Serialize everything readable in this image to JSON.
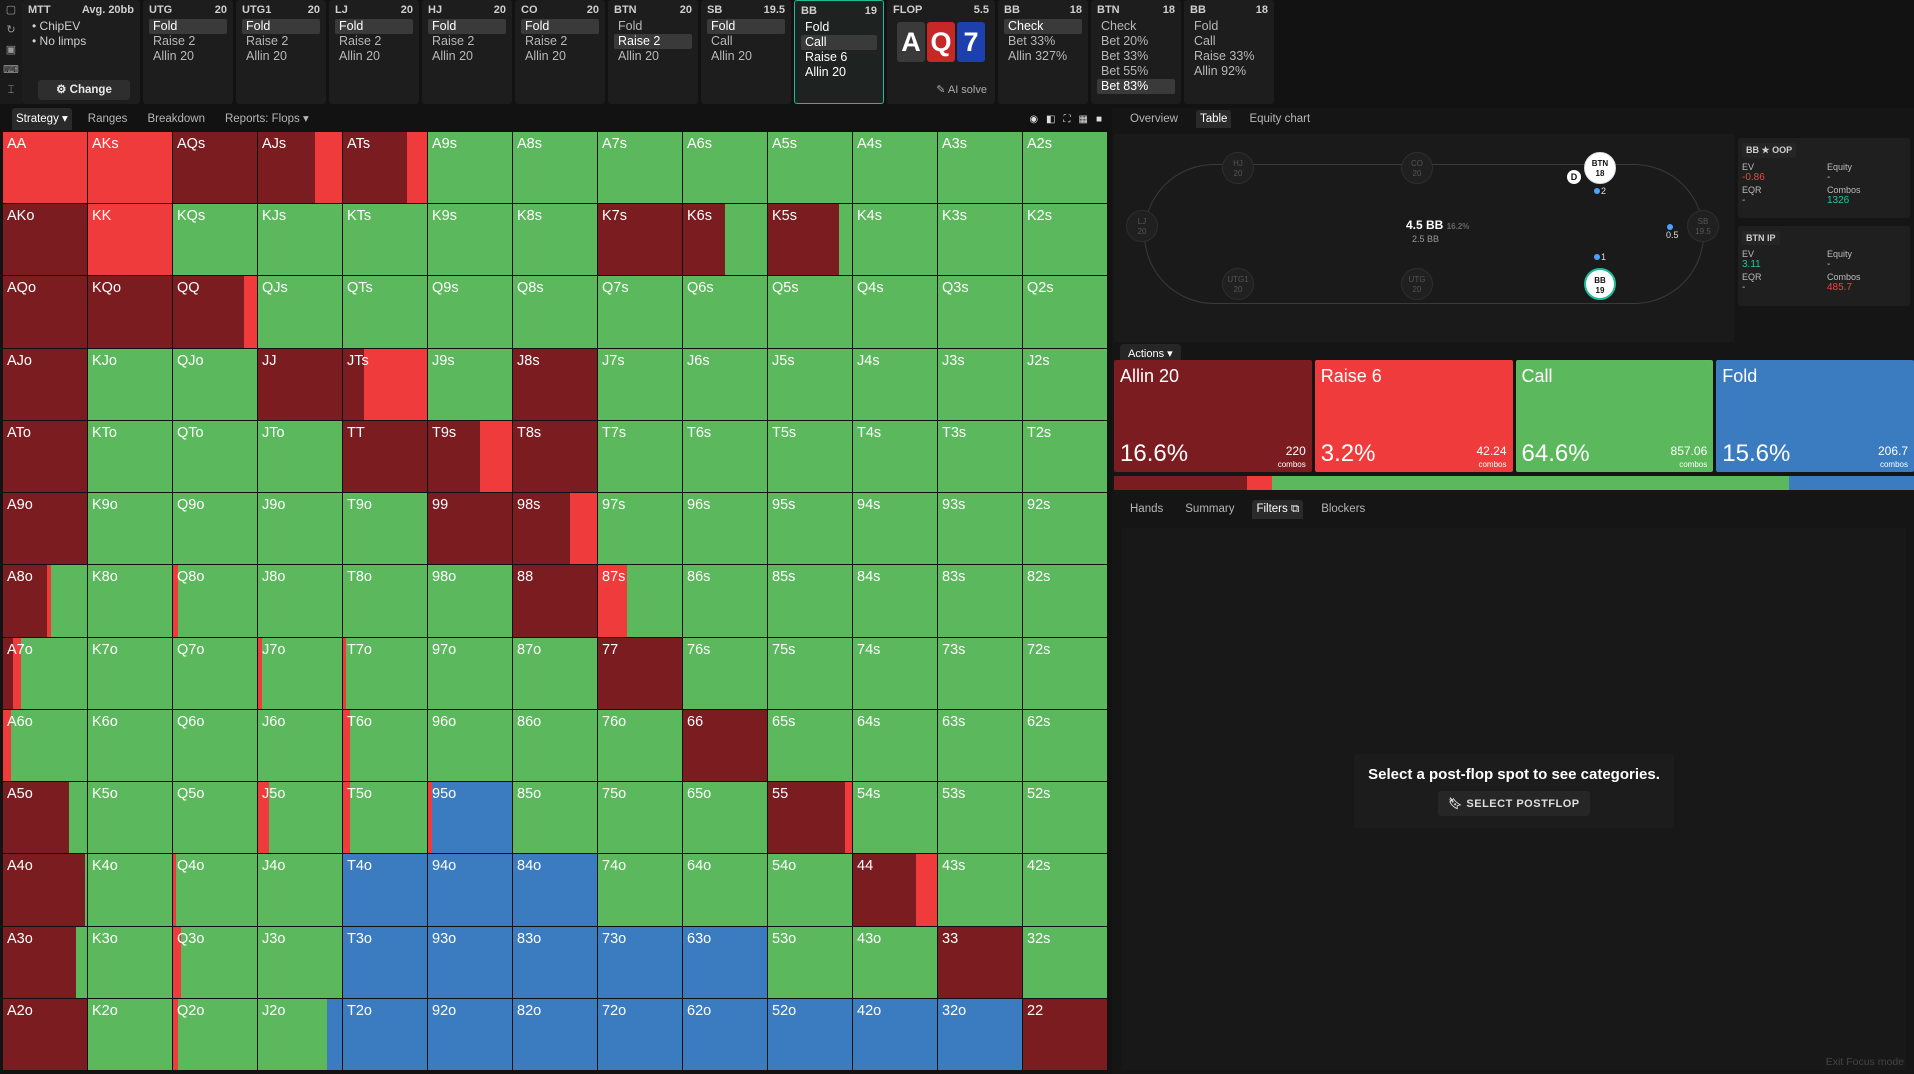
{
  "topbar": {
    "game": {
      "title": "MTT",
      "avg": "Avg. 20bb",
      "bullets": [
        "ChipEV",
        "No limps"
      ],
      "button": "Change"
    },
    "positions": [
      {
        "pos": "UTG",
        "stack": "20",
        "options": [
          "Fold",
          "Raise 2",
          "Allin 20"
        ],
        "active": 0
      },
      {
        "pos": "UTG1",
        "stack": "20",
        "options": [
          "Fold",
          "Raise 2",
          "Allin 20"
        ],
        "active": 0
      },
      {
        "pos": "LJ",
        "stack": "20",
        "options": [
          "Fold",
          "Raise 2",
          "Allin 20"
        ],
        "active": 0
      },
      {
        "pos": "HJ",
        "stack": "20",
        "options": [
          "Fold",
          "Raise 2",
          "Allin 20"
        ],
        "active": 0
      },
      {
        "pos": "CO",
        "stack": "20",
        "options": [
          "Fold",
          "Raise 2",
          "Allin 20"
        ],
        "active": 0
      },
      {
        "pos": "BTN",
        "stack": "20",
        "options": [
          "Fold",
          "Raise 2",
          "Allin 20"
        ],
        "active": 1
      },
      {
        "pos": "SB",
        "stack": "19.5",
        "options": [
          "Fold",
          "Call",
          "Allin 20"
        ],
        "active": 0
      },
      {
        "pos": "BB",
        "stack": "19",
        "options": [
          "Fold",
          "Call",
          "Raise 6",
          "Allin 20"
        ],
        "active": 1
      }
    ],
    "flop": {
      "label": "FLOP",
      "pot": "5.5",
      "cards": [
        {
          "rank": "A",
          "color": "#3a3a3a"
        },
        {
          "rank": "Q",
          "color": "#c62828"
        },
        {
          "rank": "7",
          "color": "#1e40af"
        }
      ],
      "ai": "AI solve"
    },
    "post": [
      {
        "pos": "BB",
        "stack": "18",
        "options": [
          "Check",
          "Bet 33%",
          "Allin 327%"
        ],
        "active": 0
      },
      {
        "pos": "BTN",
        "stack": "18",
        "options": [
          "Check",
          "Bet 20%",
          "Bet 33%",
          "Bet 55%",
          "Bet 83%"
        ],
        "active": 4
      },
      {
        "pos": "BB",
        "stack": "18",
        "options": [
          "Fold",
          "Call",
          "Raise 33%",
          "Allin 92%"
        ],
        "active": -1
      }
    ]
  },
  "toolbar": {
    "tabs": [
      "Strategy",
      "Ranges",
      "Breakdown",
      "Reports: Flops"
    ]
  },
  "colors": {
    "allin": "#7a1c20",
    "raise": "#ef3b3b",
    "call": "#5cb85c",
    "fold": "#3b7bbf"
  },
  "grid": [
    [
      "AA:r100",
      "AKs:r100",
      "AQs:a100",
      "AJs:a68 r32",
      "ATs:a76 r24",
      "A9s:c100",
      "A8s:c100",
      "A7s:c100",
      "A6s:c100",
      "A5s:c100",
      "A4s:c100",
      "A3s:c100",
      "A2s:c100"
    ],
    [
      "AKo:a100",
      "KK:r100",
      "KQs:c100",
      "KJs:c100",
      "KTs:c100",
      "K9s:c100",
      "K8s:c100",
      "K7s:a100",
      "K6s:a50 c50",
      "K5s:a85 c15",
      "K4s:c100",
      "K3s:c100",
      "K2s:c100"
    ],
    [
      "AQo:a100",
      "KQo:a100",
      "QQ:a85 r15",
      "QJs:c100",
      "QTs:c100",
      "Q9s:c100",
      "Q8s:c100",
      "Q7s:c100",
      "Q6s:c100",
      "Q5s:c100",
      "Q4s:c100",
      "Q3s:c100",
      "Q2s:c100"
    ],
    [
      "AJo:a100",
      "KJo:c100",
      "QJo:c100",
      "JJ:a100",
      "JTs:a25 r75",
      "J9s:c100",
      "J8s:a100",
      "J7s:c100",
      "J6s:c100",
      "J5s:c100",
      "J4s:c100",
      "J3s:c100",
      "J2s:c100"
    ],
    [
      "ATo:a100",
      "KTo:c100",
      "QTo:c100",
      "JTo:c100",
      "TT:a100",
      "T9s:a62 r38",
      "T8s:a100",
      "T7s:c100",
      "T6s:c100",
      "T5s:c100",
      "T4s:c100",
      "T3s:c100",
      "T2s:c100"
    ],
    [
      "A9o:a100",
      "K9o:c100",
      "Q9o:c100",
      "J9o:c100",
      "T9o:c100",
      "99:a100",
      "98s:a68 r32",
      "97s:c100",
      "96s:c100",
      "95s:c100",
      "94s:c100",
      "93s:c100",
      "92s:c100"
    ],
    [
      "A8o:a52 r5 c43",
      "K8o:c100",
      "Q8o:r6 c94",
      "J8o:c100",
      "T8o:c100",
      "98o:c100",
      "88:a100",
      "87s:r34 c66",
      "86s:c100",
      "85s:c100",
      "84s:c100",
      "83s:c100",
      "82s:c100"
    ],
    [
      "A7o:a12 r10 c78",
      "K7o:c100",
      "Q7o:c100",
      "J7o:r5 c95",
      "T7o:r3 c97",
      "97o:c100",
      "87o:c100",
      "77:a100",
      "76s:c100",
      "75s:c100",
      "74s:c100",
      "73s:c100",
      "72s:c100"
    ],
    [
      "A6o:r10 c90",
      "K6o:c100",
      "Q6o:c100",
      "J6o:c100",
      "T6o:r8 c92",
      "96o:c100",
      "86o:c100",
      "76o:c100",
      "66:a100",
      "65s:c100",
      "64s:c100",
      "63s:c100",
      "62s:c100"
    ],
    [
      "A5o:a78 c22",
      "K5o:c100",
      "Q5o:c100",
      "J5o:r13 c87",
      "T5o:r8 c92",
      "95o:r5 f95",
      "85o:c100",
      "75o:c100",
      "65o:c100",
      "55:a92 r8",
      "54s:c100",
      "53s:c100",
      "52s:c100"
    ],
    [
      "A4o:a98 c2",
      "K4o:c100",
      "Q4o:r4 c96",
      "J4o:c100",
      "T4o:f100",
      "94o:f100",
      "84o:f100",
      "74o:c100",
      "64o:c100",
      "54o:c100",
      "44:a75 r25",
      "43s:c100",
      "42s:c100"
    ],
    [
      "A3o:a87 c13",
      "K3o:c100",
      "Q3o:r10 c90",
      "J3o:c100",
      "T3o:f100",
      "93o:f100",
      "83o:f100",
      "73o:f100",
      "63o:f100",
      "53o:c100",
      "43o:c100",
      "33:a100",
      "32s:c100"
    ],
    [
      "A2o:a100",
      "K2o:c100",
      "Q2o:r6 c94",
      "J2o:c82 f18",
      "T2o:f100",
      "92o:f100",
      "82o:f100",
      "72o:f100",
      "62o:f100",
      "52o:f100",
      "42o:f100",
      "32o:f100",
      "22:a100"
    ]
  ],
  "right": {
    "tabs": [
      "Overview",
      "Table",
      "Equity chart"
    ],
    "seats": {
      "HJ": "HJ",
      "HJs": "20",
      "CO": "CO",
      "COs": "20",
      "BTN": "BTN",
      "BTNs": "18",
      "LJ": "LJ",
      "LJs": "20",
      "SB": "SB",
      "SBs": "19.5",
      "UTG1": "UTG1",
      "UTG1s": "20",
      "UTG": "UTG",
      "UTGs": "20",
      "BB": "BB",
      "BBs": "19"
    },
    "pot": "4.5 BB",
    "pot_pct": "16.2%",
    "pot_sub": "2.5 BB",
    "dealer": "D",
    "chip_btn": "2",
    "chip_sb": "0.5",
    "chip_bb": "1",
    "bb_stats": {
      "title": "BB ★ OOP",
      "ev_k": "EV",
      "ev": "-0.86",
      "eq_k": "Equity",
      "eq": "-",
      "eqr_k": "EQR",
      "eqr": "-",
      "co_k": "Combos",
      "co": "1326"
    },
    "btn_stats": {
      "title": "BTN IP",
      "ev_k": "EV",
      "ev": "3.11",
      "eq_k": "Equity",
      "eq": "-",
      "eqr_k": "EQR",
      "eqr": "-",
      "co_k": "Combos",
      "co": "485.7"
    },
    "actions_label": "Actions",
    "actions": [
      {
        "name": "Allin 20",
        "pct": "16.6%",
        "combos": "220",
        "cl": "combos",
        "color": "#7a1c20",
        "frac": 0.166
      },
      {
        "name": "Raise 6",
        "pct": "3.2%",
        "combos": "42.24",
        "cl": "combos",
        "color": "#ef3b3b",
        "frac": 0.032
      },
      {
        "name": "Call",
        "pct": "64.6%",
        "combos": "857.06",
        "cl": "combos",
        "color": "#5cb85c",
        "frac": 0.646
      },
      {
        "name": "Fold",
        "pct": "15.6%",
        "combos": "206.7",
        "cl": "combos",
        "color": "#3b7bbf",
        "frac": 0.156
      }
    ],
    "subtabs": [
      "Hands",
      "Summary",
      "Filters",
      "Blockers"
    ],
    "empty_msg": "Select a post-flop spot to see categories.",
    "empty_btn": "SELECT POSTFLOP",
    "exit": "Exit Focus mode"
  }
}
